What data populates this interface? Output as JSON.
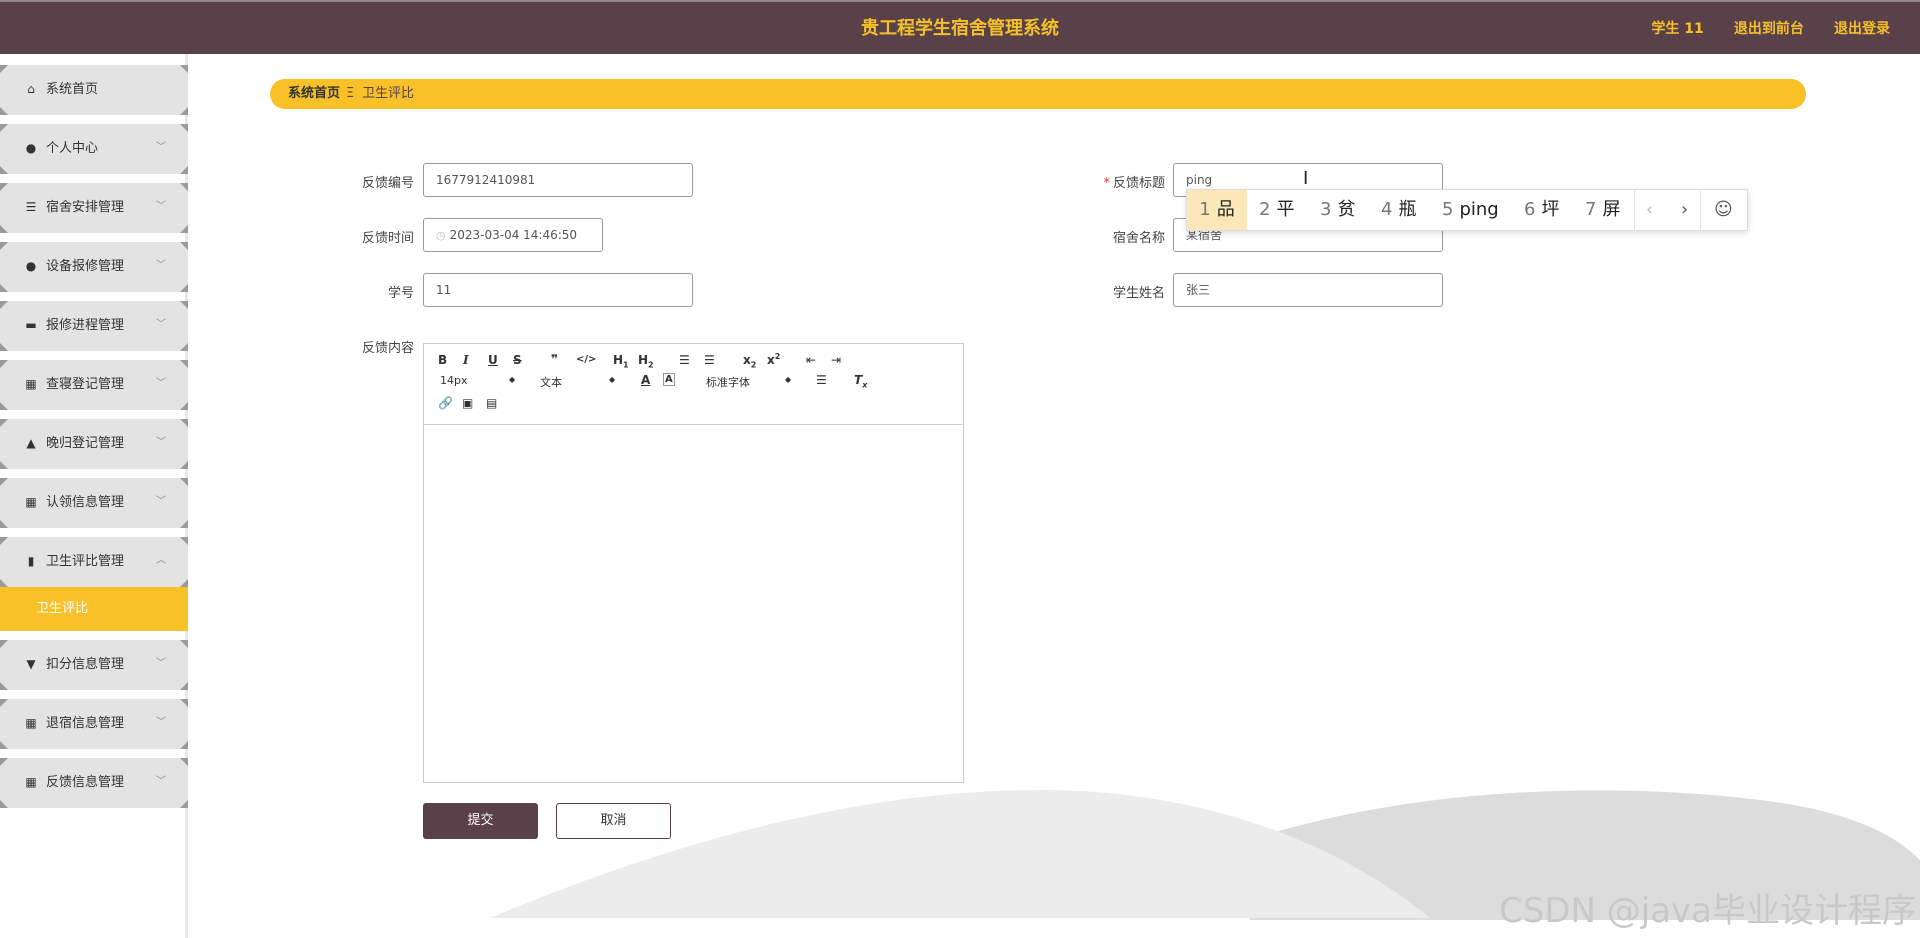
{
  "header": {
    "title": "贵工程学生宿舍管理系统",
    "user": "学生 11",
    "to_front": "退出到前台",
    "logout": "退出登录"
  },
  "sidebar": {
    "items": [
      {
        "label": "系统首页",
        "icon": "home-icon"
      },
      {
        "label": "个人中心",
        "icon": "user-icon"
      },
      {
        "label": "宿舍安排管理",
        "icon": "sliders-icon"
      },
      {
        "label": "设备报修管理",
        "icon": "user-icon"
      },
      {
        "label": "报修进程管理",
        "icon": "printer-icon"
      },
      {
        "label": "查寝登记管理",
        "icon": "grid-icon"
      },
      {
        "label": "晚归登记管理",
        "icon": "user-stand-icon"
      },
      {
        "label": "认领信息管理",
        "icon": "grid-icon"
      },
      {
        "label": "卫生评比管理",
        "icon": "books-icon"
      }
    ],
    "active_sub": "卫生评比",
    "items_after": [
      {
        "label": "扣分信息管理",
        "icon": "pin-icon"
      },
      {
        "label": "退宿信息管理",
        "icon": "grid-icon"
      },
      {
        "label": "反馈信息管理",
        "icon": "grid-icon"
      }
    ]
  },
  "breadcrumb": {
    "home": "系统首页",
    "separator": "Ξ",
    "current": "卫生评比"
  },
  "form": {
    "feedback_no_label": "反馈编号",
    "feedback_no": "1677912410981",
    "feedback_title_label": "反馈标题",
    "feedback_title": "ping",
    "feedback_time_label": "反馈时间",
    "feedback_time": "2023-03-04 14:46:50",
    "dorm_name_label": "宿舍名称",
    "dorm_name": "某宿舍",
    "student_no_label": "学号",
    "student_no": "11",
    "student_name_label": "学生姓名",
    "student_name": "张三",
    "content_label": "反馈内容",
    "required_mark": "*",
    "submit": "提交",
    "cancel": "取消"
  },
  "editor": {
    "font_size": "14px",
    "block_type": "文本",
    "font_family": "标准字体"
  },
  "ime": {
    "candidates": [
      {
        "num": "1",
        "text": "品"
      },
      {
        "num": "2",
        "text": "平"
      },
      {
        "num": "3",
        "text": "贫"
      },
      {
        "num": "4",
        "text": "瓶"
      },
      {
        "num": "5",
        "text": "ping"
      },
      {
        "num": "6",
        "text": "坪"
      },
      {
        "num": "7",
        "text": "屏"
      }
    ],
    "prev": "‹",
    "next": "›",
    "emoji": "☺"
  },
  "watermark": "CSDN @java毕业设计程序",
  "colors": {
    "header": "#5a4048",
    "accent": "#f7c127"
  }
}
